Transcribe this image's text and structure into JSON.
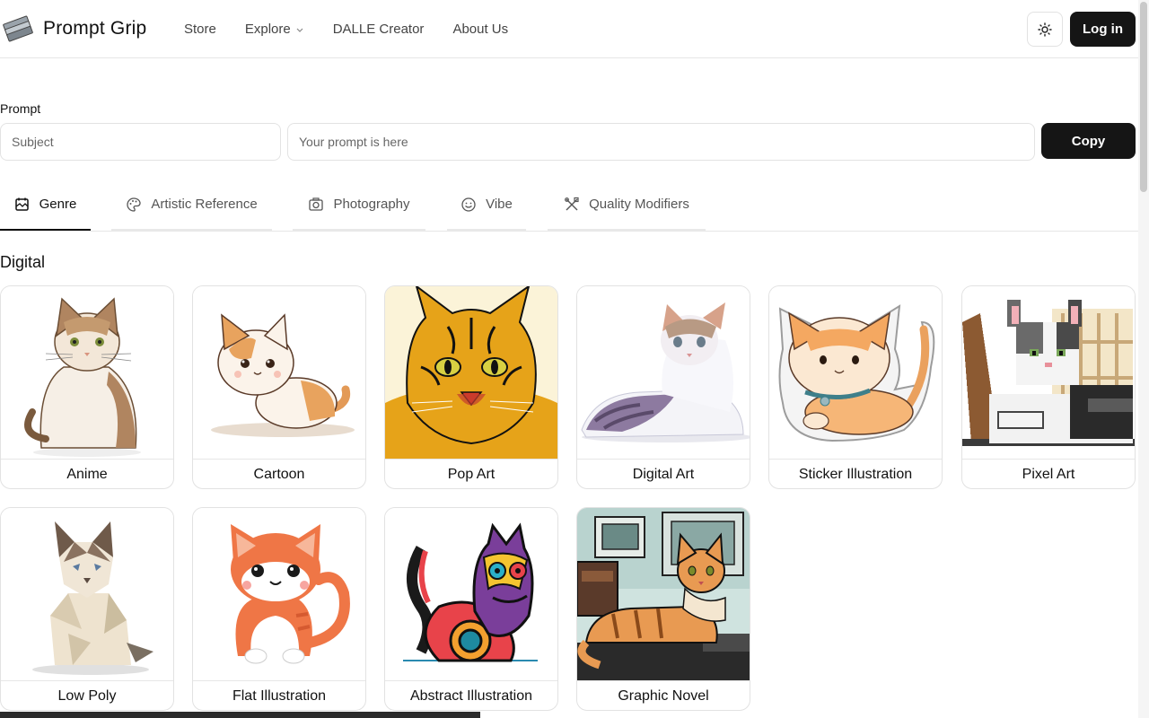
{
  "header": {
    "logo_text": "Prompt Grip",
    "nav": [
      {
        "label": "Store"
      },
      {
        "label": "Explore",
        "has_dropdown": true
      },
      {
        "label": "DALLE Creator"
      },
      {
        "label": "About Us"
      }
    ],
    "login_label": "Log in"
  },
  "prompt": {
    "label": "Prompt",
    "subject_placeholder": "Subject",
    "prompt_placeholder": "Your prompt is here",
    "copy_label": "Copy"
  },
  "tabs": [
    {
      "label": "Genre",
      "icon": "genre-icon",
      "active": true
    },
    {
      "label": "Artistic Reference",
      "icon": "palette-icon",
      "active": false
    },
    {
      "label": "Photography",
      "icon": "camera-icon",
      "active": false
    },
    {
      "label": "Vibe",
      "icon": "smiley-icon",
      "active": false
    },
    {
      "label": "Quality Modifiers",
      "icon": "tools-icon",
      "active": false
    }
  ],
  "section": {
    "title": "Digital"
  },
  "cards": [
    {
      "label": "Anime"
    },
    {
      "label": "Cartoon"
    },
    {
      "label": "Pop Art"
    },
    {
      "label": "Digital Art"
    },
    {
      "label": "Sticker Illustration"
    },
    {
      "label": "Pixel Art"
    },
    {
      "label": "Low Poly"
    },
    {
      "label": "Flat Illustration"
    },
    {
      "label": "Abstract Illustration"
    },
    {
      "label": "Graphic Novel"
    }
  ],
  "colors": {
    "primary_button": "#151515",
    "border": "#e2e2e2"
  }
}
